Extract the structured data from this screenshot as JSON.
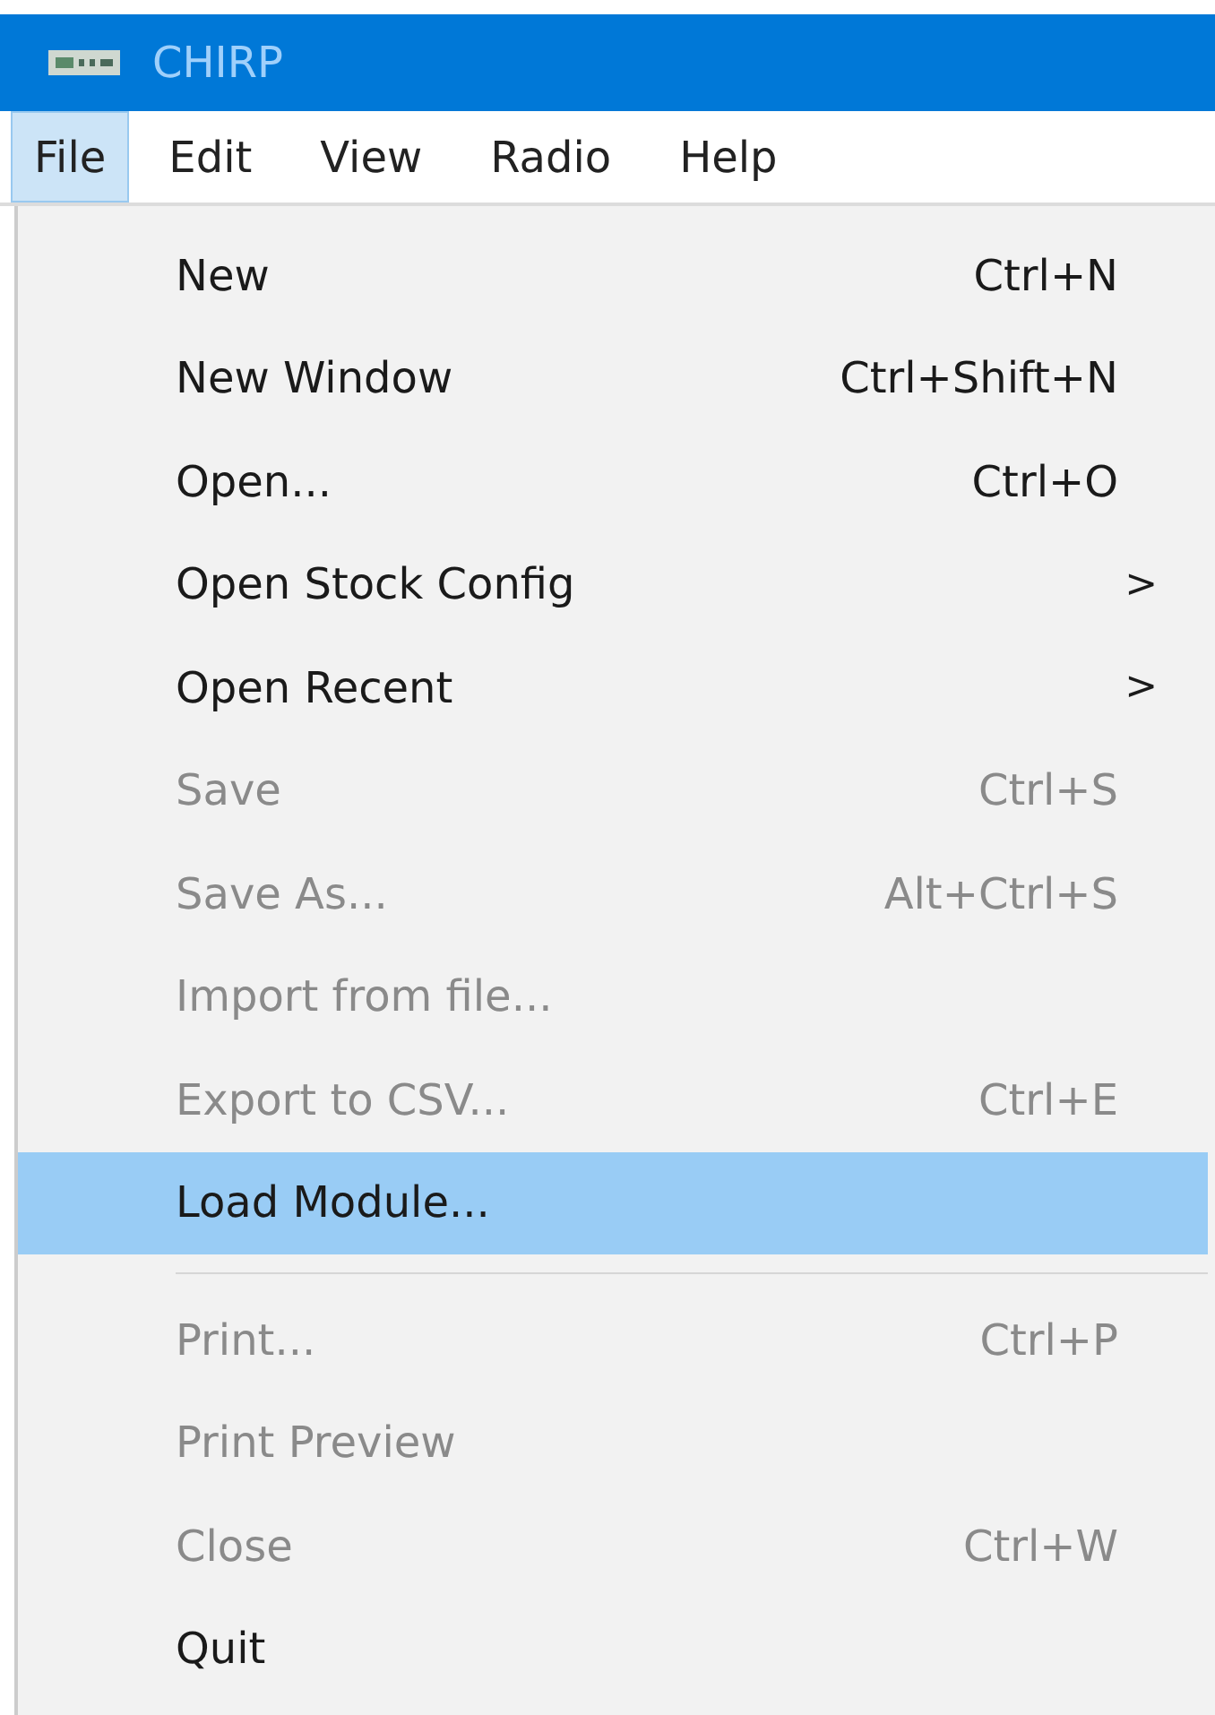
{
  "window": {
    "title": "CHIRP"
  },
  "menubar": [
    {
      "label": "File",
      "selected": true
    },
    {
      "label": "Edit",
      "selected": false
    },
    {
      "label": "View",
      "selected": false
    },
    {
      "label": "Radio",
      "selected": false
    },
    {
      "label": "Help",
      "selected": false
    }
  ],
  "menu": {
    "items": [
      {
        "kind": "item",
        "label": "New",
        "shortcut": "Ctrl+N",
        "disabled": false,
        "selected": false
      },
      {
        "kind": "item",
        "label": "New Window",
        "shortcut": "Ctrl+Shift+N",
        "disabled": false,
        "selected": false
      },
      {
        "kind": "item",
        "label": "Open...",
        "shortcut": "Ctrl+O",
        "disabled": false,
        "selected": false
      },
      {
        "kind": "item",
        "label": "Open Stock Config",
        "submenu": ">",
        "disabled": false,
        "selected": false
      },
      {
        "kind": "item",
        "label": "Open Recent",
        "submenu": ">",
        "disabled": false,
        "selected": false
      },
      {
        "kind": "item",
        "label": "Save",
        "shortcut": "Ctrl+S",
        "disabled": true,
        "selected": false
      },
      {
        "kind": "item",
        "label": "Save As...",
        "shortcut": "Alt+Ctrl+S",
        "disabled": true,
        "selected": false
      },
      {
        "kind": "item",
        "label": "Import from file...",
        "disabled": true,
        "selected": false
      },
      {
        "kind": "item",
        "label": "Export to CSV...",
        "shortcut": "Ctrl+E",
        "disabled": true,
        "selected": false
      },
      {
        "kind": "item",
        "label": "Load Module...",
        "disabled": false,
        "selected": true
      },
      {
        "kind": "separator"
      },
      {
        "kind": "item",
        "label": "Print...",
        "shortcut": "Ctrl+P",
        "disabled": true,
        "selected": false
      },
      {
        "kind": "item",
        "label": "Print Preview",
        "disabled": true,
        "selected": false
      },
      {
        "kind": "item",
        "label": "Close",
        "shortcut": "Ctrl+W",
        "disabled": true,
        "selected": false
      },
      {
        "kind": "item",
        "label": "Quit",
        "disabled": false,
        "selected": false
      }
    ]
  }
}
